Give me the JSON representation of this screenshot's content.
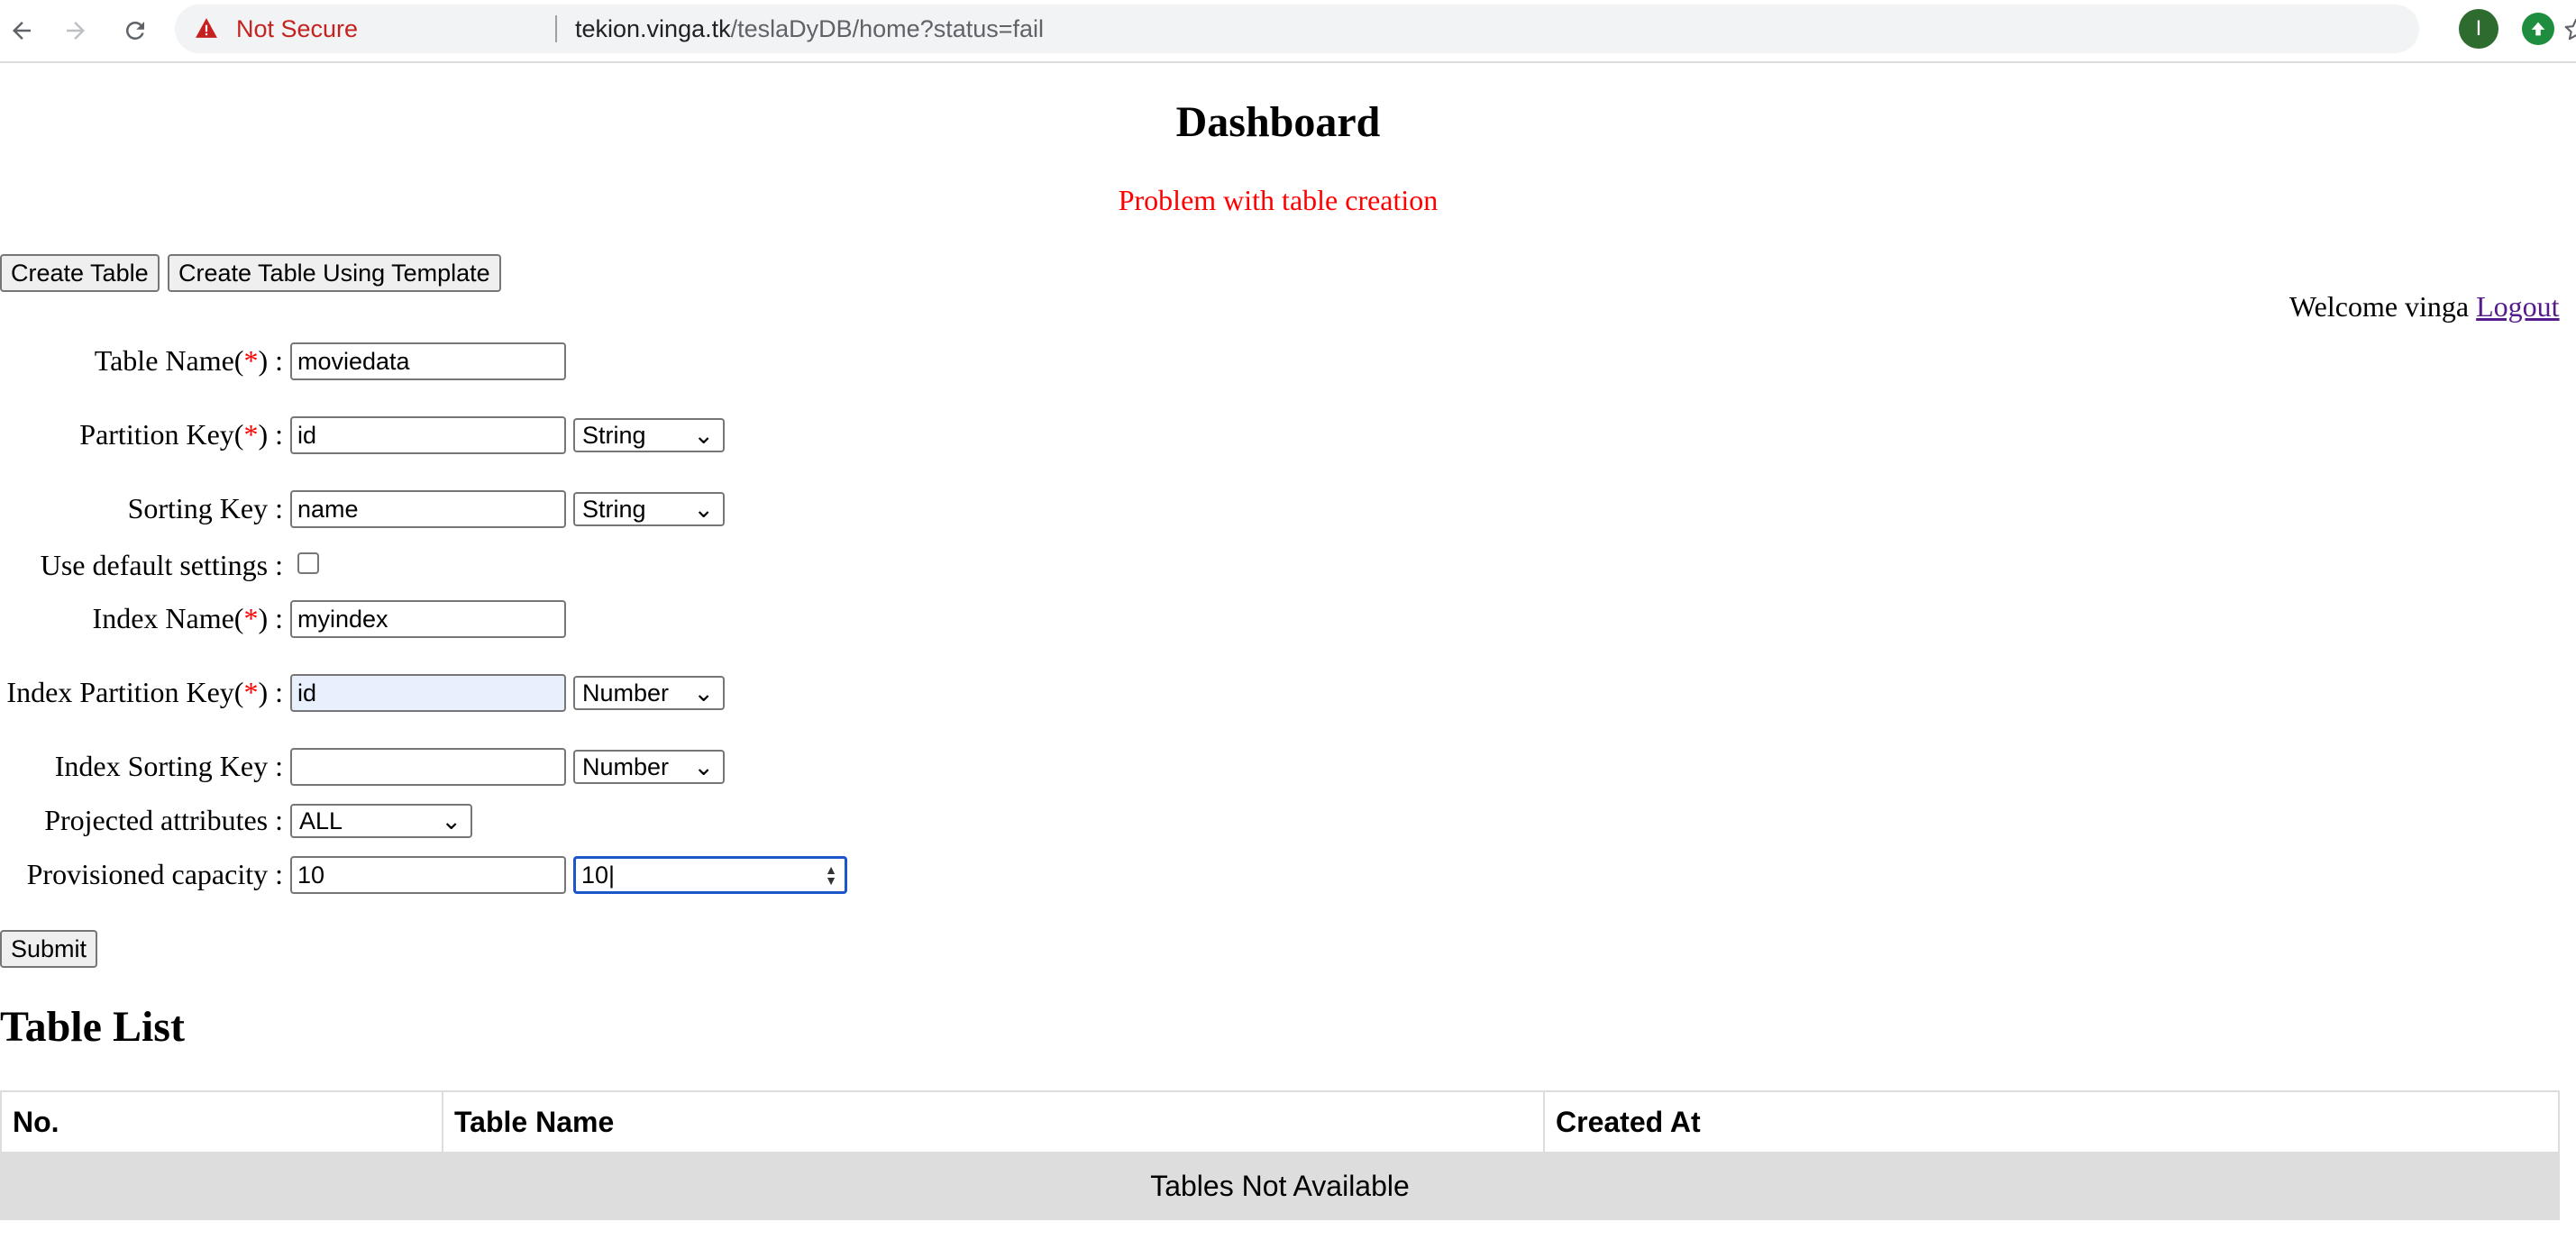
{
  "browser": {
    "security_label": "Not Secure",
    "url_host": "tekion.vinga.tk",
    "url_path": "/teslaDyDB/home?status=fail",
    "profile_initial": "I"
  },
  "page": {
    "title": "Dashboard",
    "status_message": "Problem with table creation",
    "welcome_text": "Welcome vinga",
    "logout_label": "Logout"
  },
  "actions": {
    "create_table": "Create Table",
    "create_from_template": "Create Table Using Template",
    "submit": "Submit"
  },
  "form": {
    "table_name": {
      "label": "Table Name(",
      "req": "*",
      "suffix": ") :",
      "value": "moviedata"
    },
    "partition_key": {
      "label": "Partition Key(",
      "req": "*",
      "suffix": ") :",
      "value": "id",
      "type": "String"
    },
    "sorting_key": {
      "label": "Sorting Key :",
      "value": "name",
      "type": "String"
    },
    "use_default": {
      "label": "Use default settings :",
      "checked": false
    },
    "index_name": {
      "label": "Index Name(",
      "req": "*",
      "suffix": ") :",
      "value": "myindex"
    },
    "index_partition_key": {
      "label": "Index Partition Key(",
      "req": "*",
      "suffix": ") :",
      "value": "id",
      "type": "Number"
    },
    "index_sorting_key": {
      "label": "Index Sorting Key :",
      "value": "",
      "type": "Number"
    },
    "projected_attributes": {
      "label": "Projected attributes :",
      "value": "ALL"
    },
    "provisioned_capacity": {
      "label": "Provisioned capacity :",
      "read": "10",
      "write": "10"
    }
  },
  "table_list": {
    "title": "Table List",
    "columns": [
      "No.",
      "Table Name",
      "Created At"
    ],
    "empty_message": "Tables Not Available"
  },
  "colors": {
    "error": "#ff0000",
    "link_visited": "#551a8b",
    "focus": "#1a56c9",
    "autofill": "#e8f0fe"
  }
}
